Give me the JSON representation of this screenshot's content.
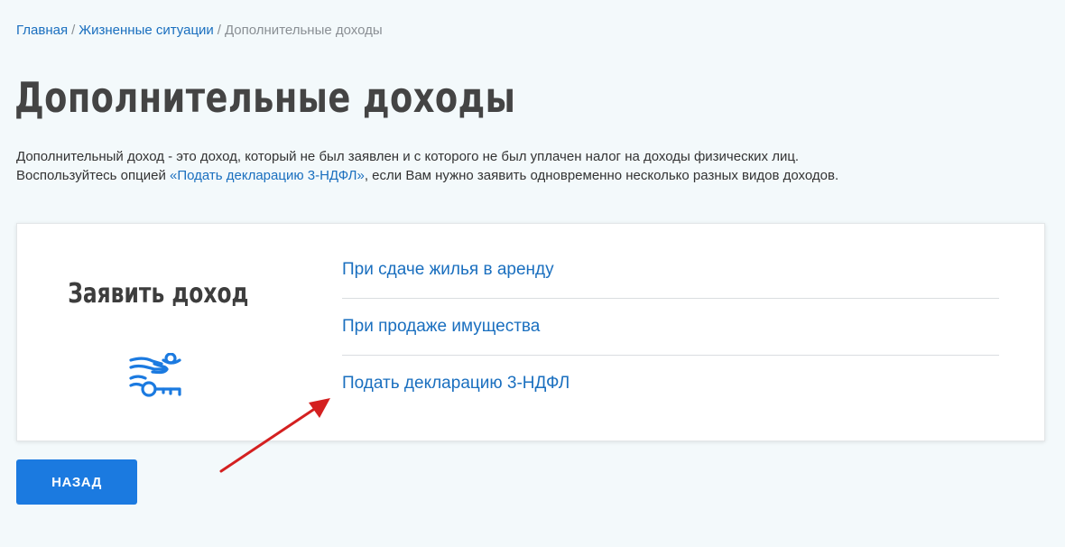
{
  "breadcrumb": {
    "items": [
      {
        "label": "Главная"
      },
      {
        "label": "Жизненные ситуации"
      }
    ],
    "separator": "/",
    "current": "Дополнительные доходы"
  },
  "page": {
    "title": "Дополнительные доходы",
    "intro_line1": "Дополнительный доход - это доход, который не был заявлен и с которого не был уплачен налог на доходы физических лиц.",
    "intro_line2_before": "Воспользуйтесь опцией ",
    "intro_link": "«Подать декларацию 3-НДФЛ»",
    "intro_line2_after": ", если Вам нужно заявить одновременно несколько разных видов доходов."
  },
  "card": {
    "heading": "Заявить доход",
    "icon": "hand-with-keys-icon",
    "links": [
      {
        "label": "При сдаче жилья в аренду"
      },
      {
        "label": "При продаже имущества"
      },
      {
        "label": "Подать декларацию 3-НДФЛ"
      }
    ]
  },
  "back_button": {
    "label": "НАЗАД"
  },
  "colors": {
    "background": "#f3f9fb",
    "link": "#1a6fbf",
    "button": "#1b7ae0",
    "arrow": "#d42020",
    "title": "#444444"
  }
}
